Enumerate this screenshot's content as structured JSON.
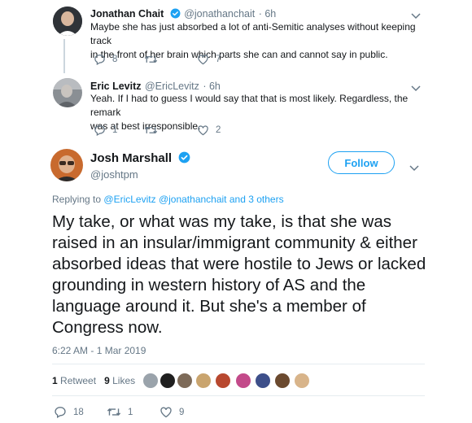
{
  "tweets": [
    {
      "name": "Jonathan Chait",
      "handle": "@jonathanchait",
      "time": "· 6h",
      "text_line1": "Maybe she has just absorbed a lot of anti-Semitic analyses without keeping track",
      "text_line2": "in the front of her brain which parts she can and cannot say in public.",
      "reply_count": "8",
      "retweet_count": "",
      "like_count": "7",
      "verified": true
    },
    {
      "name": "Eric Levitz",
      "handle": "@EricLevitz",
      "time": "· 6h",
      "text_line1": "Yeah. If I had to guess I would say that that is most likely. Regardless, the remark",
      "text_line2": "was at best irresponsible.",
      "reply_count": "1",
      "retweet_count": "",
      "like_count": "2",
      "verified": false
    }
  ],
  "main_tweet": {
    "name": "Josh Marshall",
    "handle": "@joshtpm",
    "follow_label": "Follow",
    "replying_prefix": "Replying to",
    "replying_user1": "@EricLevitz",
    "replying_user2": "@jonathanchait",
    "replying_suffix": "and 3 others",
    "text": "My take, or what was my take, is that she was raised in an insular/immigrant community & either absorbed ideas that were hostile to Jews or lacked grounding in western history of AS and the language around it. But she's a member of Congress now.",
    "timestamp": "6:22 AM - 1 Mar 2019",
    "retweets_num": "1",
    "retweets_label": "Retweet",
    "likes_num": "9",
    "likes_label": "Likes",
    "reply_count": "18",
    "retweet_count": "1",
    "like_count": "9"
  },
  "colors": {
    "accent": "#1da1f2",
    "secondary_text": "#657786",
    "divider": "#e6ecf0"
  },
  "icons": [
    "reply-icon",
    "retweet-icon",
    "like-icon",
    "chevron-down-icon",
    "verified-badge-icon"
  ]
}
